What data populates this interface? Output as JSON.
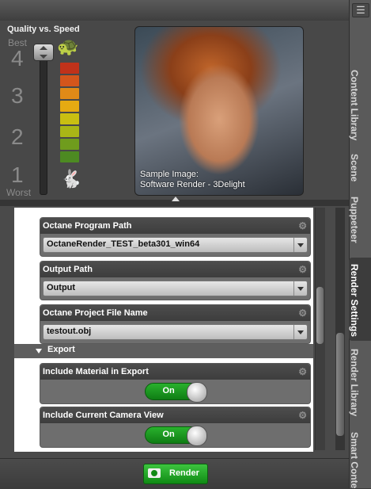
{
  "quality": {
    "title": "Quality vs. Speed",
    "best_label": "Best",
    "worst_label": "Worst",
    "levels": [
      "4",
      "3",
      "2",
      "1"
    ],
    "current_level": 4,
    "bar_colors": [
      "#c0321a",
      "#d4561c",
      "#e08a17",
      "#e5aa12",
      "#c9bf12",
      "#a9b616",
      "#6f9c1d",
      "#4d8a22",
      "#2f7a25",
      "#2a6b23"
    ],
    "slow_icon": "turtle-icon",
    "fast_icon": "rabbit-icon"
  },
  "sample": {
    "caption_line1": "Sample Image:",
    "caption_line2": "Software Render - 3Delight"
  },
  "properties": [
    {
      "label": "Octane Program Path",
      "value": "OctaneRender_TEST_beta301_win64"
    },
    {
      "label": "Output Path",
      "value": "Output"
    },
    {
      "label": "Octane Project File Name",
      "value": "testout.obj"
    }
  ],
  "group": {
    "label": "Export"
  },
  "toggles": [
    {
      "label": "Include Material in Export",
      "state": "On"
    },
    {
      "label": "Include Current Camera View",
      "state": "On"
    }
  ],
  "render_button": {
    "label": "Render"
  },
  "tabs": [
    "Content Library",
    "Scene",
    "Puppeteer",
    "Render Settings",
    "Render Library",
    "Smart Conte"
  ],
  "active_tab": "Render Settings",
  "accent_green": "#1a9a1e"
}
